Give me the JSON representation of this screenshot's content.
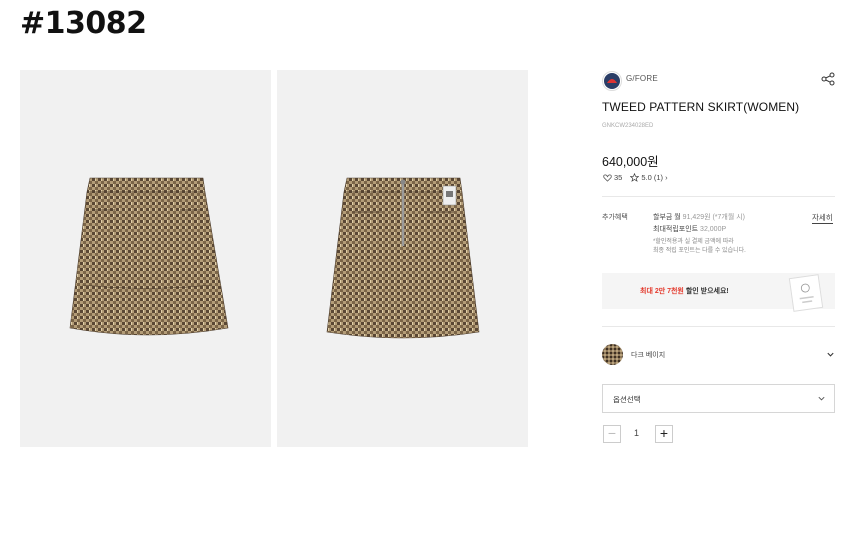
{
  "page_id": "#13082",
  "product": {
    "brand": "G/FORE",
    "title": "TWEED PATTERN SKIRT(WOMEN)",
    "sku": "GNKCW234028ED",
    "price": "640,000원",
    "likes": "35",
    "rating": "5.0 (1) ›"
  },
  "benefits": {
    "label": "추가혜택",
    "installment_prefix": "할부금 월",
    "installment_detail": "91,429원 (*7개월 시)",
    "points_prefix": "최대적립포인트",
    "points_value": "32,000P",
    "note_line1": "*할인적용과 실 결제 금액에 따라",
    "note_line2": "최종 적립 포인트는 다를 수 있습니다.",
    "detail_link": "자세히"
  },
  "coupon": {
    "highlight": "최대 2만 7천원",
    "rest": " 할인 받으세요!"
  },
  "color_option": {
    "name": "다크 베이지"
  },
  "option_select": {
    "label": "옵션선택"
  },
  "quantity": {
    "value": "1",
    "minus": "−",
    "plus": "+"
  },
  "colors": {
    "tweed_base": "#6b5a44",
    "tweed_light": "#c9b48f",
    "background_photo": "#f1f1f1",
    "accent_red": "#e43b2e"
  }
}
